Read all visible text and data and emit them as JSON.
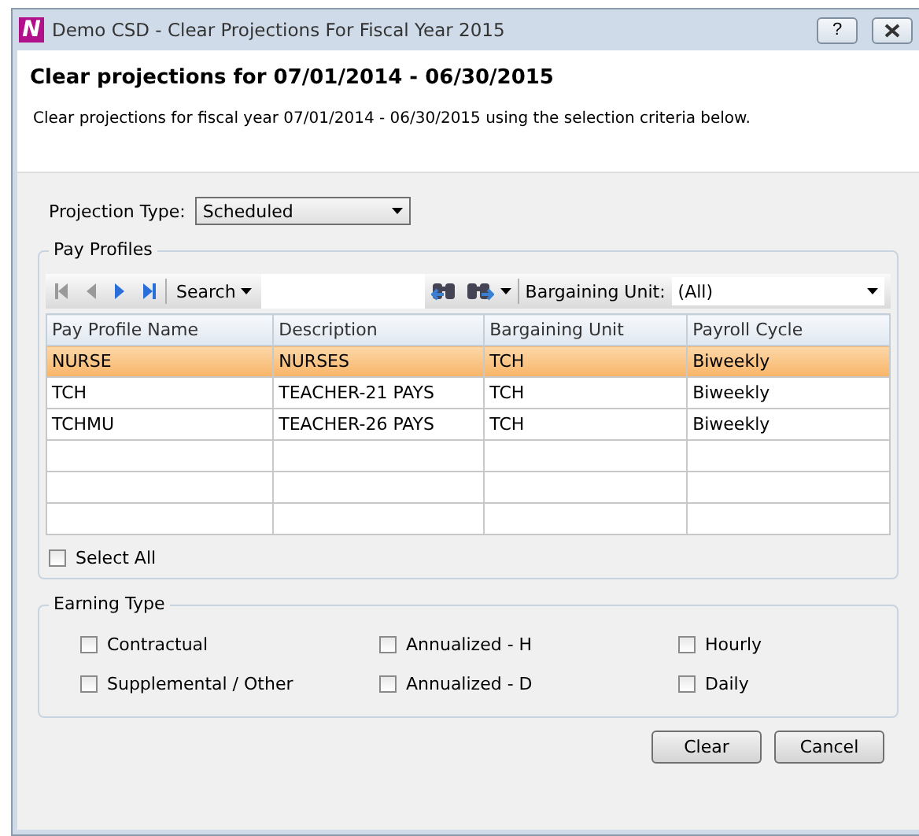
{
  "window": {
    "title": "Demo CSD - Clear Projections For Fiscal Year 2015",
    "logo": "N",
    "help_button": "?"
  },
  "header": {
    "heading": "Clear projections for 07/01/2014 - 06/30/2015",
    "description": "Clear projections for fiscal year 07/01/2014 - 06/30/2015 using the selection criteria below."
  },
  "projection_type": {
    "label": "Projection Type:",
    "value": "Scheduled"
  },
  "pay_profiles": {
    "title": "Pay Profiles",
    "toolbar": {
      "search_label": "Search",
      "bargaining_unit_label": "Bargaining Unit:",
      "bargaining_unit_value": "(All)"
    },
    "table": {
      "columns": [
        "Pay Profile Name",
        "Description",
        "Bargaining Unit",
        "Payroll Cycle"
      ],
      "rows": [
        {
          "cells": [
            "NURSE",
            "NURSES",
            "TCH",
            "Biweekly"
          ],
          "selected": true
        },
        {
          "cells": [
            "TCH",
            "TEACHER-21 PAYS",
            "TCH",
            "Biweekly"
          ],
          "selected": false
        },
        {
          "cells": [
            "TCHMU",
            "TEACHER-26 PAYS",
            "TCH",
            "Biweekly"
          ],
          "selected": false
        }
      ]
    },
    "select_all": {
      "label": "Select All",
      "checked": false
    }
  },
  "earning_type": {
    "title": "Earning Type",
    "options": [
      {
        "label": "Contractual",
        "checked": false
      },
      {
        "label": "Annualized - H",
        "checked": false
      },
      {
        "label": "Hourly",
        "checked": false
      },
      {
        "label": "Supplemental / Other",
        "checked": false
      },
      {
        "label": "Annualized - D",
        "checked": false
      },
      {
        "label": "Daily",
        "checked": false
      }
    ]
  },
  "buttons": [
    "Clear",
    "Cancel"
  ]
}
